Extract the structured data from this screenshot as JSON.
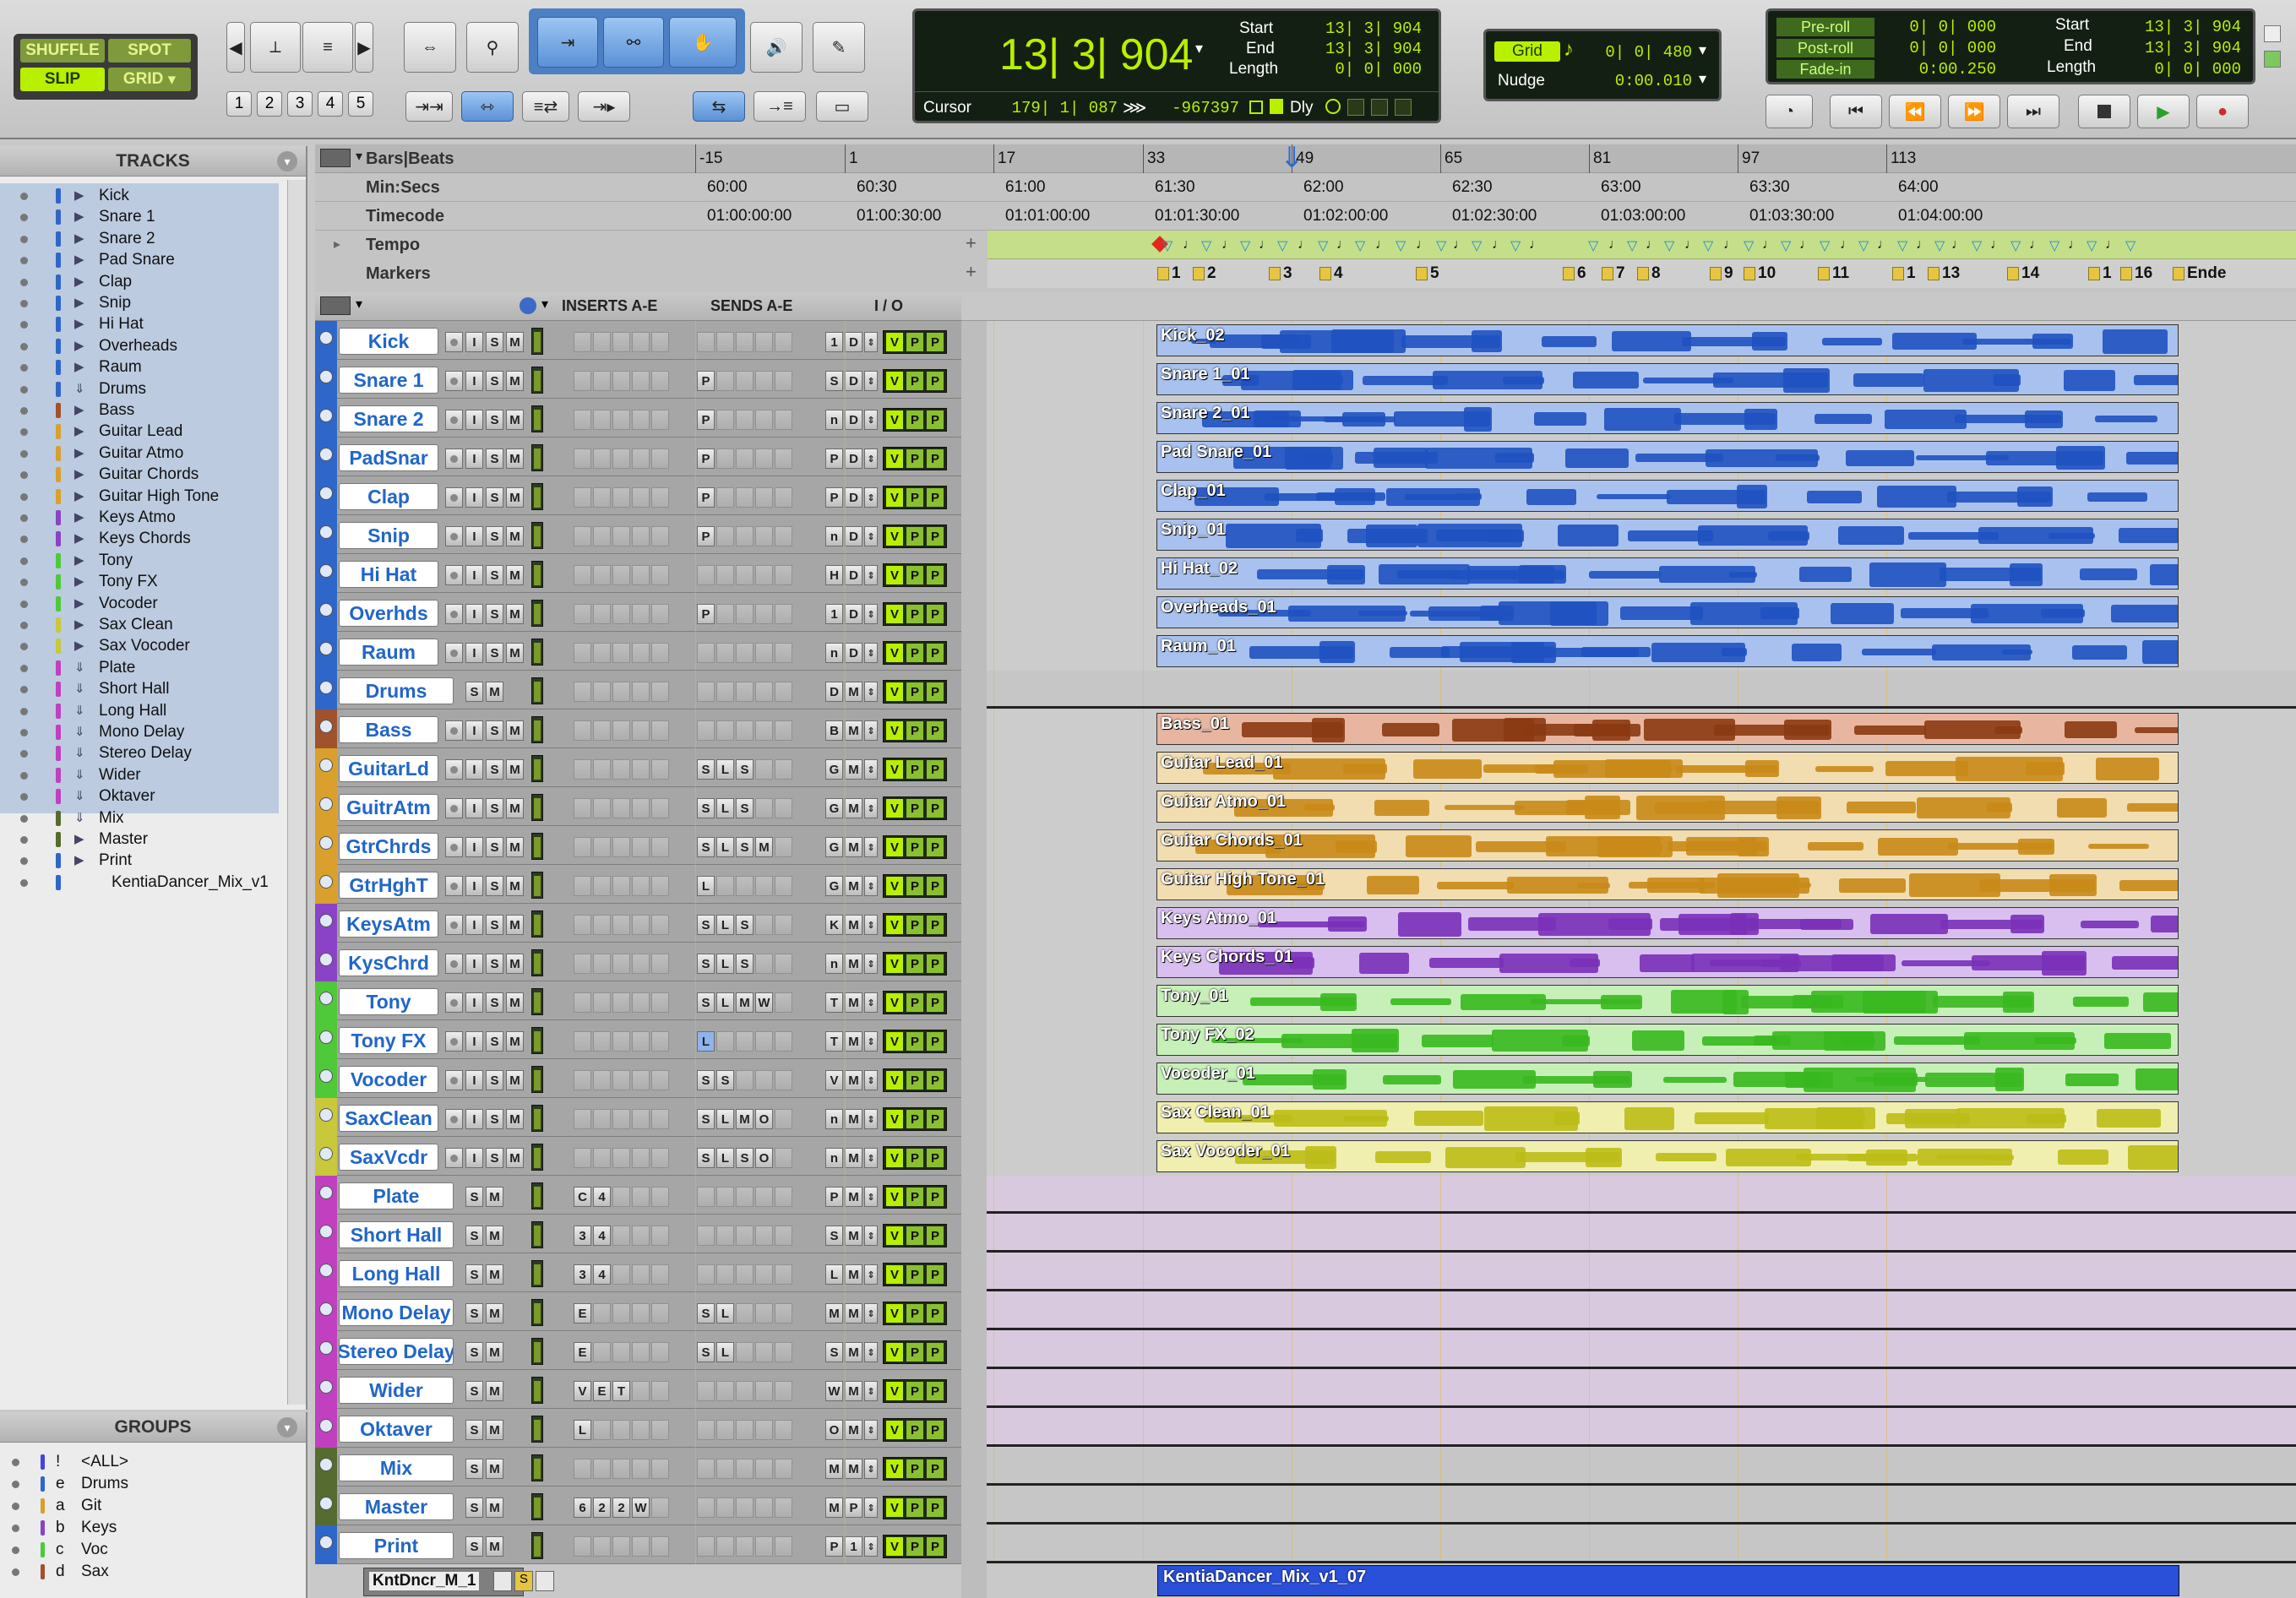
{
  "modes": {
    "shuffle": "SHUFFLE",
    "spot": "SPOT",
    "slip": "SLIP",
    "grid": "GRID"
  },
  "zoom_presets": [
    "1",
    "2",
    "3",
    "4",
    "5"
  ],
  "counter": {
    "main": "13| 3| 904",
    "start_label": "Start",
    "end_label": "End",
    "length_label": "Length",
    "start": "13| 3| 904",
    "end": "13| 3| 904",
    "length": "0| 0| 000",
    "cursor_label": "Cursor",
    "cursor": "179| 1| 087",
    "sample": "-967397",
    "dly": "Dly"
  },
  "grid": {
    "grid_label": "Grid",
    "grid_value": "0| 0| 480",
    "nudge_label": "Nudge",
    "nudge_value": "0:00.010"
  },
  "roll": {
    "preroll_label": "Pre-roll",
    "postroll_label": "Post-roll",
    "fadein_label": "Fade-in",
    "preroll": "0| 0| 000",
    "postroll": "0| 0| 000",
    "fadein": "0:00.250",
    "start_label": "Start",
    "end_label": "End",
    "length_label": "Length",
    "start": "13| 3| 904",
    "end": "13| 3| 904",
    "length": "0| 0| 000"
  },
  "tracks_panel": {
    "title": "TRACKS"
  },
  "groups_panel": {
    "title": "GROUPS"
  },
  "track_list": [
    {
      "name": "Kick",
      "color": "#2f66c9",
      "icon": "▶"
    },
    {
      "name": "Snare 1",
      "color": "#2f66c9",
      "icon": "▶"
    },
    {
      "name": "Snare 2",
      "color": "#2f66c9",
      "icon": "▶"
    },
    {
      "name": "Pad Snare",
      "color": "#2f66c9",
      "icon": "▶"
    },
    {
      "name": "Clap",
      "color": "#2f66c9",
      "icon": "▶"
    },
    {
      "name": "Snip",
      "color": "#2f66c9",
      "icon": "▶"
    },
    {
      "name": "Hi Hat",
      "color": "#2f66c9",
      "icon": "▶"
    },
    {
      "name": "Overheads",
      "color": "#2f66c9",
      "icon": "▶"
    },
    {
      "name": "Raum",
      "color": "#2f66c9",
      "icon": "▶"
    },
    {
      "name": "Drums",
      "color": "#2f66c9",
      "icon": "⇓"
    },
    {
      "name": "Bass",
      "color": "#a0522d",
      "icon": "▶"
    },
    {
      "name": "Guitar Lead",
      "color": "#d9a02d",
      "icon": "▶"
    },
    {
      "name": "Guitar Atmo",
      "color": "#d9a02d",
      "icon": "▶"
    },
    {
      "name": "Guitar Chords",
      "color": "#d9a02d",
      "icon": "▶"
    },
    {
      "name": "Guitar High Tone",
      "color": "#d9a02d",
      "icon": "▶"
    },
    {
      "name": "Keys Atmo",
      "color": "#8a43c7",
      "icon": "▶"
    },
    {
      "name": "Keys Chords",
      "color": "#8a43c7",
      "icon": "▶"
    },
    {
      "name": "Tony",
      "color": "#4fc83a",
      "icon": "▶"
    },
    {
      "name": "Tony FX",
      "color": "#4fc83a",
      "icon": "▶"
    },
    {
      "name": "Vocoder",
      "color": "#4fc83a",
      "icon": "▶"
    },
    {
      "name": "Sax Clean",
      "color": "#c8c83a",
      "icon": "▶"
    },
    {
      "name": "Sax Vocoder",
      "color": "#c8c83a",
      "icon": "▶"
    },
    {
      "name": "Plate",
      "color": "#c040c0",
      "icon": "⇓"
    },
    {
      "name": "Short Hall",
      "color": "#c040c0",
      "icon": "⇓"
    },
    {
      "name": "Long Hall",
      "color": "#c040c0",
      "icon": "⇓"
    },
    {
      "name": "Mono Delay",
      "color": "#c040c0",
      "icon": "⇓"
    },
    {
      "name": "Stereo Delay",
      "color": "#c040c0",
      "icon": "⇓"
    },
    {
      "name": "Wider",
      "color": "#c040c0",
      "icon": "⇓"
    },
    {
      "name": "Oktaver",
      "color": "#c040c0",
      "icon": "⇓"
    },
    {
      "name": "Mix",
      "color": "#556b2f",
      "icon": "⇓"
    },
    {
      "name": "Master",
      "color": "#556b2f",
      "icon": "▶"
    },
    {
      "name": "Print",
      "color": "#2f66c9",
      "icon": "▶"
    },
    {
      "name": "KentiaDancer_Mix_v1",
      "color": "#2f66c9",
      "icon": ""
    }
  ],
  "groups": [
    {
      "id": "!",
      "name": "<ALL>",
      "color": "#4444dd"
    },
    {
      "id": "e",
      "name": "Drums",
      "color": "#2f66c9"
    },
    {
      "id": "a",
      "name": "Git",
      "color": "#d9a02d"
    },
    {
      "id": "b",
      "name": "Keys",
      "color": "#8a43c7"
    },
    {
      "id": "c",
      "name": "Voc",
      "color": "#4fc83a"
    },
    {
      "id": "d",
      "name": "Sax",
      "color": "#a0522d"
    }
  ],
  "rulers": {
    "bars": "Bars|Beats",
    "minsecs": "Min:Secs",
    "timecode": "Timecode",
    "tempo": "Tempo",
    "markers": "Markers"
  },
  "bar_ticks": [
    "-15",
    "1",
    "17",
    "33",
    "49",
    "65",
    "81",
    "97",
    "113"
  ],
  "min_ticks": [
    "60:00",
    "60:30",
    "61:00",
    "61:30",
    "62:00",
    "62:30",
    "63:00",
    "63:30",
    "64:00"
  ],
  "tc_ticks": [
    "01:00:00:00",
    "01:00:30:00",
    "01:01:00:00",
    "01:01:30:00",
    "01:02:00:00",
    "01:02:30:00",
    "01:03:00:00",
    "01:03:30:00",
    "01:04:00:00"
  ],
  "markers": [
    "1",
    "2",
    "3",
    "4",
    "5",
    "6",
    "7",
    "8",
    "9",
    "10",
    "11",
    "1",
    "13",
    "14",
    "1",
    "16",
    "Ende"
  ],
  "columns": {
    "inserts": "INSERTS A-E",
    "sends": "SENDS A-E",
    "io": "I / O"
  },
  "tracks": [
    {
      "name": "Kick",
      "color": "#2f66c9",
      "clip": "Kick_02",
      "io": "1",
      "io2": "D",
      "send": "",
      "clipcolor": "#a9c1ee",
      "wave": "#1f52c0"
    },
    {
      "name": "Snare 1",
      "color": "#2f66c9",
      "clip": "Snare 1_01",
      "io": "S",
      "io2": "D",
      "send": "P",
      "clipcolor": "#a9c1ee",
      "wave": "#1f52c0"
    },
    {
      "name": "Snare 2",
      "color": "#2f66c9",
      "clip": "Snare 2_01",
      "io": "n",
      "io2": "D",
      "send": "P",
      "clipcolor": "#a9c1ee",
      "wave": "#1f52c0"
    },
    {
      "name": "PadSnar",
      "color": "#2f66c9",
      "clip": "Pad Snare_01",
      "io": "P",
      "io2": "D",
      "send": "P",
      "clipcolor": "#a9c1ee",
      "wave": "#1f52c0"
    },
    {
      "name": "Clap",
      "color": "#2f66c9",
      "clip": "Clap_01",
      "io": "P",
      "io2": "D",
      "send": "P",
      "clipcolor": "#a9c1ee",
      "wave": "#1f52c0"
    },
    {
      "name": "Snip",
      "color": "#2f66c9",
      "clip": "Snip_01",
      "io": "n",
      "io2": "D",
      "send": "P",
      "clipcolor": "#a9c1ee",
      "wave": "#1f52c0"
    },
    {
      "name": "Hi Hat",
      "color": "#2f66c9",
      "clip": "Hi Hat_02",
      "io": "H",
      "io2": "D",
      "send": "",
      "clipcolor": "#a9c1ee",
      "wave": "#1f52c0"
    },
    {
      "name": "Overhds",
      "color": "#2f66c9",
      "clip": "Overheads_01",
      "io": "1",
      "io2": "D",
      "send": "P",
      "clipcolor": "#a9c1ee",
      "wave": "#1f52c0"
    },
    {
      "name": "Raum",
      "color": "#2f66c9",
      "clip": "Raum_01",
      "io": "n",
      "io2": "D",
      "send": "",
      "clipcolor": "#a9c1ee",
      "wave": "#1f52c0"
    },
    {
      "name": "Drums",
      "color": "#2f66c9",
      "clip": "",
      "io": "D",
      "io2": "M",
      "send": "",
      "clipcolor": "",
      "wave": ""
    },
    {
      "name": "Bass",
      "color": "#a0522d",
      "clip": "Bass_01",
      "io": "B",
      "io2": "M",
      "send": "",
      "clipcolor": "#e8b6a0",
      "wave": "#8a3a12"
    },
    {
      "name": "GuitarLd",
      "color": "#d9a02d",
      "clip": "Guitar Lead_01",
      "io": "G",
      "io2": "M",
      "send": "S L S",
      "clipcolor": "#f2ddb0",
      "wave": "#c98a18"
    },
    {
      "name": "GuitrAtm",
      "color": "#d9a02d",
      "clip": "Guitar Atmo_01",
      "io": "G",
      "io2": "M",
      "send": "S L S",
      "clipcolor": "#f2ddb0",
      "wave": "#c98a18"
    },
    {
      "name": "GtrChrds",
      "color": "#d9a02d",
      "clip": "Guitar Chords_01",
      "io": "G",
      "io2": "M",
      "send": "S L S M",
      "clipcolor": "#f2ddb0",
      "wave": "#c98a18"
    },
    {
      "name": "GtrHghT",
      "color": "#d9a02d",
      "clip": "Guitar High Tone_01",
      "io": "G",
      "io2": "M",
      "send": "L",
      "clipcolor": "#f2ddb0",
      "wave": "#c98a18"
    },
    {
      "name": "KeysAtm",
      "color": "#8a43c7",
      "clip": "Keys Atmo_01",
      "io": "K",
      "io2": "M",
      "send": "S L S",
      "clipcolor": "#d8bff0",
      "wave": "#7a30b8"
    },
    {
      "name": "KysChrd",
      "color": "#8a43c7",
      "clip": "Keys Chords_01",
      "io": "n",
      "io2": "M",
      "send": "S L S",
      "clipcolor": "#d8bff0",
      "wave": "#7a30b8"
    },
    {
      "name": "Tony",
      "color": "#4fc83a",
      "clip": "Tony_01",
      "io": "T",
      "io2": "M",
      "send": "S L M W",
      "clipcolor": "#c6f0b8",
      "wave": "#38b81f"
    },
    {
      "name": "Tony FX",
      "color": "#4fc83a",
      "clip": "Tony FX_02",
      "io": "T",
      "io2": "M",
      "send": "L",
      "clipcolor": "#c6f0b8",
      "wave": "#38b81f"
    },
    {
      "name": "Vocoder",
      "color": "#4fc83a",
      "clip": "Vocoder_01",
      "io": "V",
      "io2": "M",
      "send": "S S",
      "clipcolor": "#c6f0b8",
      "wave": "#38b81f"
    },
    {
      "name": "SaxClean",
      "color": "#c8c83a",
      "clip": "Sax Clean_01",
      "io": "n",
      "io2": "M",
      "send": "S L M O",
      "clipcolor": "#f0efb0",
      "wave": "#bcbc18"
    },
    {
      "name": "SaxVcdr",
      "color": "#c8c83a",
      "clip": "Sax Vocoder_01",
      "io": "n",
      "io2": "M",
      "send": "S L S O",
      "clipcolor": "#f0efb0",
      "wave": "#bcbc18"
    },
    {
      "name": "Plate",
      "color": "#c040c0",
      "clip": "",
      "io": "P",
      "io2": "M",
      "send": "",
      "clipcolor": "",
      "wave": "",
      "ins": "C 4"
    },
    {
      "name": "Short Hall",
      "color": "#c040c0",
      "clip": "",
      "io": "S",
      "io2": "M",
      "send": "",
      "clipcolor": "",
      "wave": "",
      "ins": "3 4"
    },
    {
      "name": "Long Hall",
      "color": "#c040c0",
      "clip": "",
      "io": "L",
      "io2": "M",
      "send": "",
      "clipcolor": "",
      "wave": "",
      "ins": "3 4"
    },
    {
      "name": "Mono Delay",
      "color": "#c040c0",
      "clip": "",
      "io": "M",
      "io2": "M",
      "send": "S L",
      "clipcolor": "",
      "wave": "",
      "ins": "E"
    },
    {
      "name": "Stereo Delay",
      "color": "#c040c0",
      "clip": "",
      "io": "S",
      "io2": "M",
      "send": "S L",
      "clipcolor": "",
      "wave": "",
      "ins": "E"
    },
    {
      "name": "Wider",
      "color": "#c040c0",
      "clip": "",
      "io": "W",
      "io2": "M",
      "send": "",
      "clipcolor": "",
      "wave": "",
      "ins": "V E T"
    },
    {
      "name": "Oktaver",
      "color": "#c040c0",
      "clip": "",
      "io": "O",
      "io2": "M",
      "send": "",
      "clipcolor": "",
      "wave": "",
      "ins": "L"
    },
    {
      "name": "Mix",
      "color": "#556b2f",
      "clip": "",
      "io": "M",
      "io2": "M",
      "send": "",
      "clipcolor": "",
      "wave": ""
    },
    {
      "name": "Master",
      "color": "#556b2f",
      "clip": "",
      "io": "M",
      "io2": "P",
      "send": "",
      "clipcolor": "",
      "wave": "",
      "ins": "6 2 2 W"
    },
    {
      "name": "Print",
      "color": "#2f66c9",
      "clip": "",
      "io": "P",
      "io2": "1",
      "send": "",
      "clipcolor": "",
      "wave": ""
    }
  ],
  "playlist": {
    "name": "KntDncr_M_1"
  },
  "bottom_clip": "KentiaDancer_Mix_v1_07"
}
